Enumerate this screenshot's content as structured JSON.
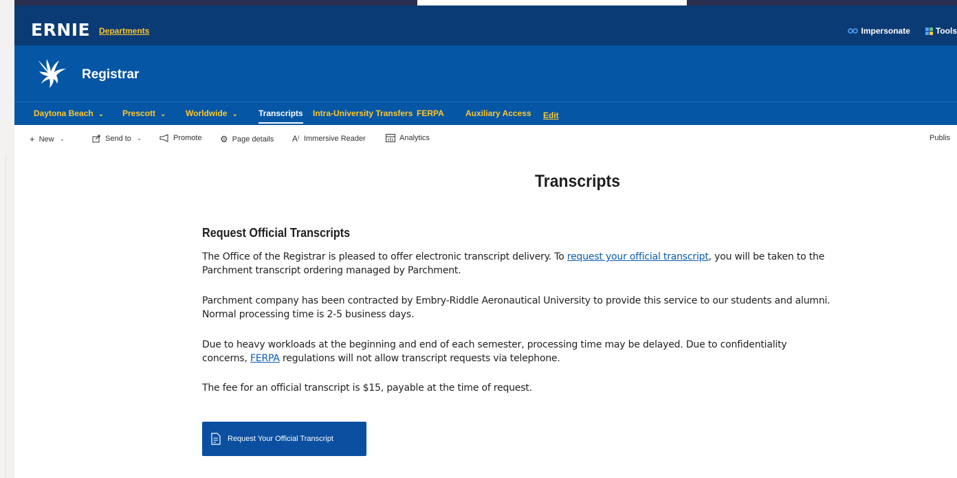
{
  "suite": {
    "logo": "ERNIE",
    "departments_label": "Departments",
    "impersonate_label": "Impersonate",
    "tools_label": "Tools"
  },
  "site": {
    "title": "Registrar"
  },
  "nav": {
    "items": [
      {
        "label": "Daytona Beach",
        "has_dropdown": true
      },
      {
        "label": "Prescott",
        "has_dropdown": true
      },
      {
        "label": "Worldwide",
        "has_dropdown": true
      },
      {
        "label": "Transcripts",
        "active": true
      },
      {
        "label": "Intra-University Transfers"
      },
      {
        "label": "FERPA"
      },
      {
        "label": "Auxiliary Access"
      }
    ],
    "edit_label": "Edit"
  },
  "commandbar": {
    "new_label": "New",
    "send_to_label": "Send to",
    "promote_label": "Promote",
    "page_details_label": "Page details",
    "immersive_reader_label": "Immersive Reader",
    "analytics_label": "Analytics",
    "publish_label": "Publis"
  },
  "content": {
    "page_title": "Transcripts",
    "heading": "Request Official Transcripts",
    "p1_before": "The Office of the Registrar is pleased to offer electronic transcript delivery. To ",
    "p1_link": "request your official transcript",
    "p1_after": ", you will be taken to the Parchment transcript ordering managed by Parchment.",
    "p2": "Parchment company has been contracted by Embry-Riddle Aeronautical University to provide this service to our students and alumni.  Normal processing time is 2-5 business days.",
    "p3_before": "Due to heavy workloads at the beginning and end of each semester, processing time may be delayed. Due to confidentiality concerns, ",
    "p3_link": "FERPA",
    "p3_after": " regulations will not allow transcript requests via telephone.",
    "p4": "The fee for an official transcript is $15, payable at the time of request.",
    "cta_label": "Request Your Official Transcript"
  },
  "colors": {
    "suitebar": "#0b3b74",
    "sitehead": "#0556a4",
    "accent_gold": "#ffc72c",
    "link": "#0b5cad",
    "cta": "#0b4fa0"
  }
}
